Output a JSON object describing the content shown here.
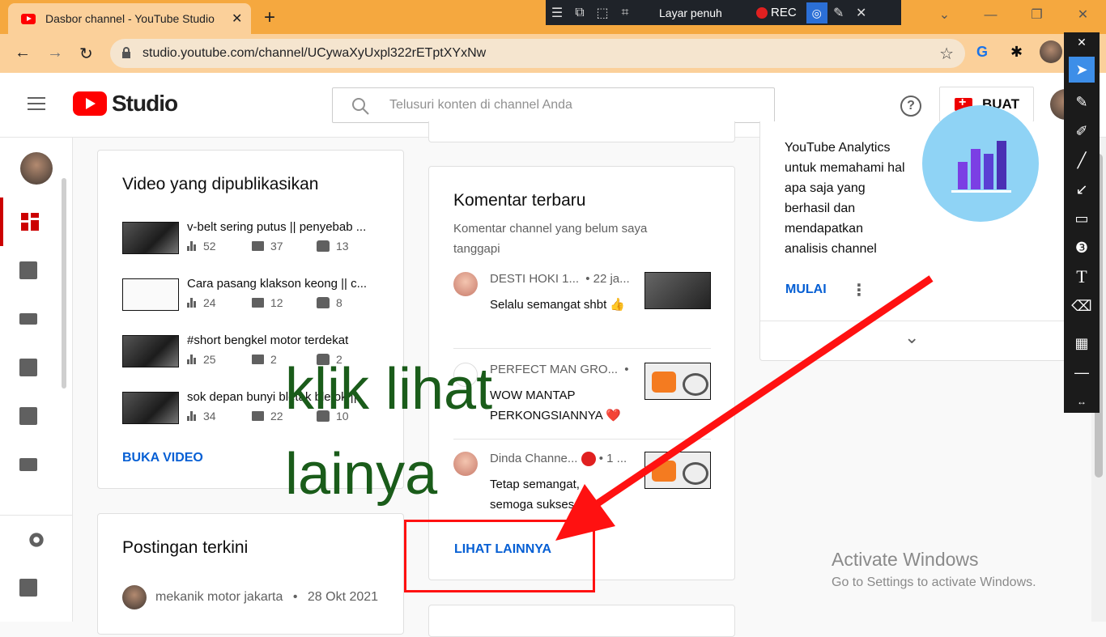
{
  "browser": {
    "tab_title": "Dasbor channel - YouTube Studio",
    "tab_close": "✕",
    "new_tab": "+",
    "url": "studio.youtube.com/channel/UCywaXyUxpl322rETptXYxNw",
    "window_controls": [
      "⌄",
      "—",
      "❐",
      "✕"
    ]
  },
  "recorder": {
    "fullscreen_label": "Layar penuh",
    "rec_label": "REC"
  },
  "studio": {
    "logo_text": "Studio",
    "search_placeholder": "Telusuri konten di channel Anda",
    "help": "?",
    "create_label": "BUAT"
  },
  "published": {
    "title": "Video yang dipublikasikan",
    "videos": [
      {
        "title": "v-belt sering putus || penyebab ...",
        "views": "52",
        "comments": "37",
        "likes": "13"
      },
      {
        "title": "Cara pasang klakson keong || c...",
        "views": "24",
        "comments": "12",
        "likes": "8"
      },
      {
        "title": "#short bengkel motor terdekat",
        "views": "25",
        "comments": "2",
        "likes": "2"
      },
      {
        "title": "sok depan bunyi bletak bletok ||",
        "views": "34",
        "comments": "22",
        "likes": "10"
      }
    ],
    "link": "BUKA VIDEO"
  },
  "posts": {
    "title": "Postingan terkini",
    "author": "mekanik motor jakarta",
    "sep": "•",
    "date": "28 Okt 2021"
  },
  "comments": {
    "title": "Komentar terbaru",
    "subtitle": "Komentar channel yang belum saya tanggapi",
    "items": [
      {
        "name": "DESTI HOKI 1...",
        "meta": "• 22 ja...",
        "text": "Selalu semangat shbt 👍"
      },
      {
        "name": "PERFECT MAN GRO...",
        "meta": "•",
        "text": "WOW MANTAP PERKONGSIANNYA ❤️"
      },
      {
        "name": "Dinda Channe...",
        "meta": "• 1 ...",
        "text": "Tetap semangat, semoga sukses"
      }
    ],
    "link": "LIHAT LAINNYA"
  },
  "analytics": {
    "text": "YouTube Analytics untuk memahami hal apa saja yang berhasil dan mendapatkan analisis channel",
    "link": "MULAI",
    "more": "⋮",
    "expand": "⌄"
  },
  "annotation": {
    "line1": "klik lihat",
    "line2": "lainya"
  },
  "watermark": {
    "line1": "Activate Windows",
    "line2": "Go to Settings to activate Windows."
  },
  "colors": {
    "accent_link": "#065fd4",
    "annotation_green": "#1a5c1a",
    "annotation_red": "#ff1111",
    "tabbar": "#f5a83f"
  }
}
